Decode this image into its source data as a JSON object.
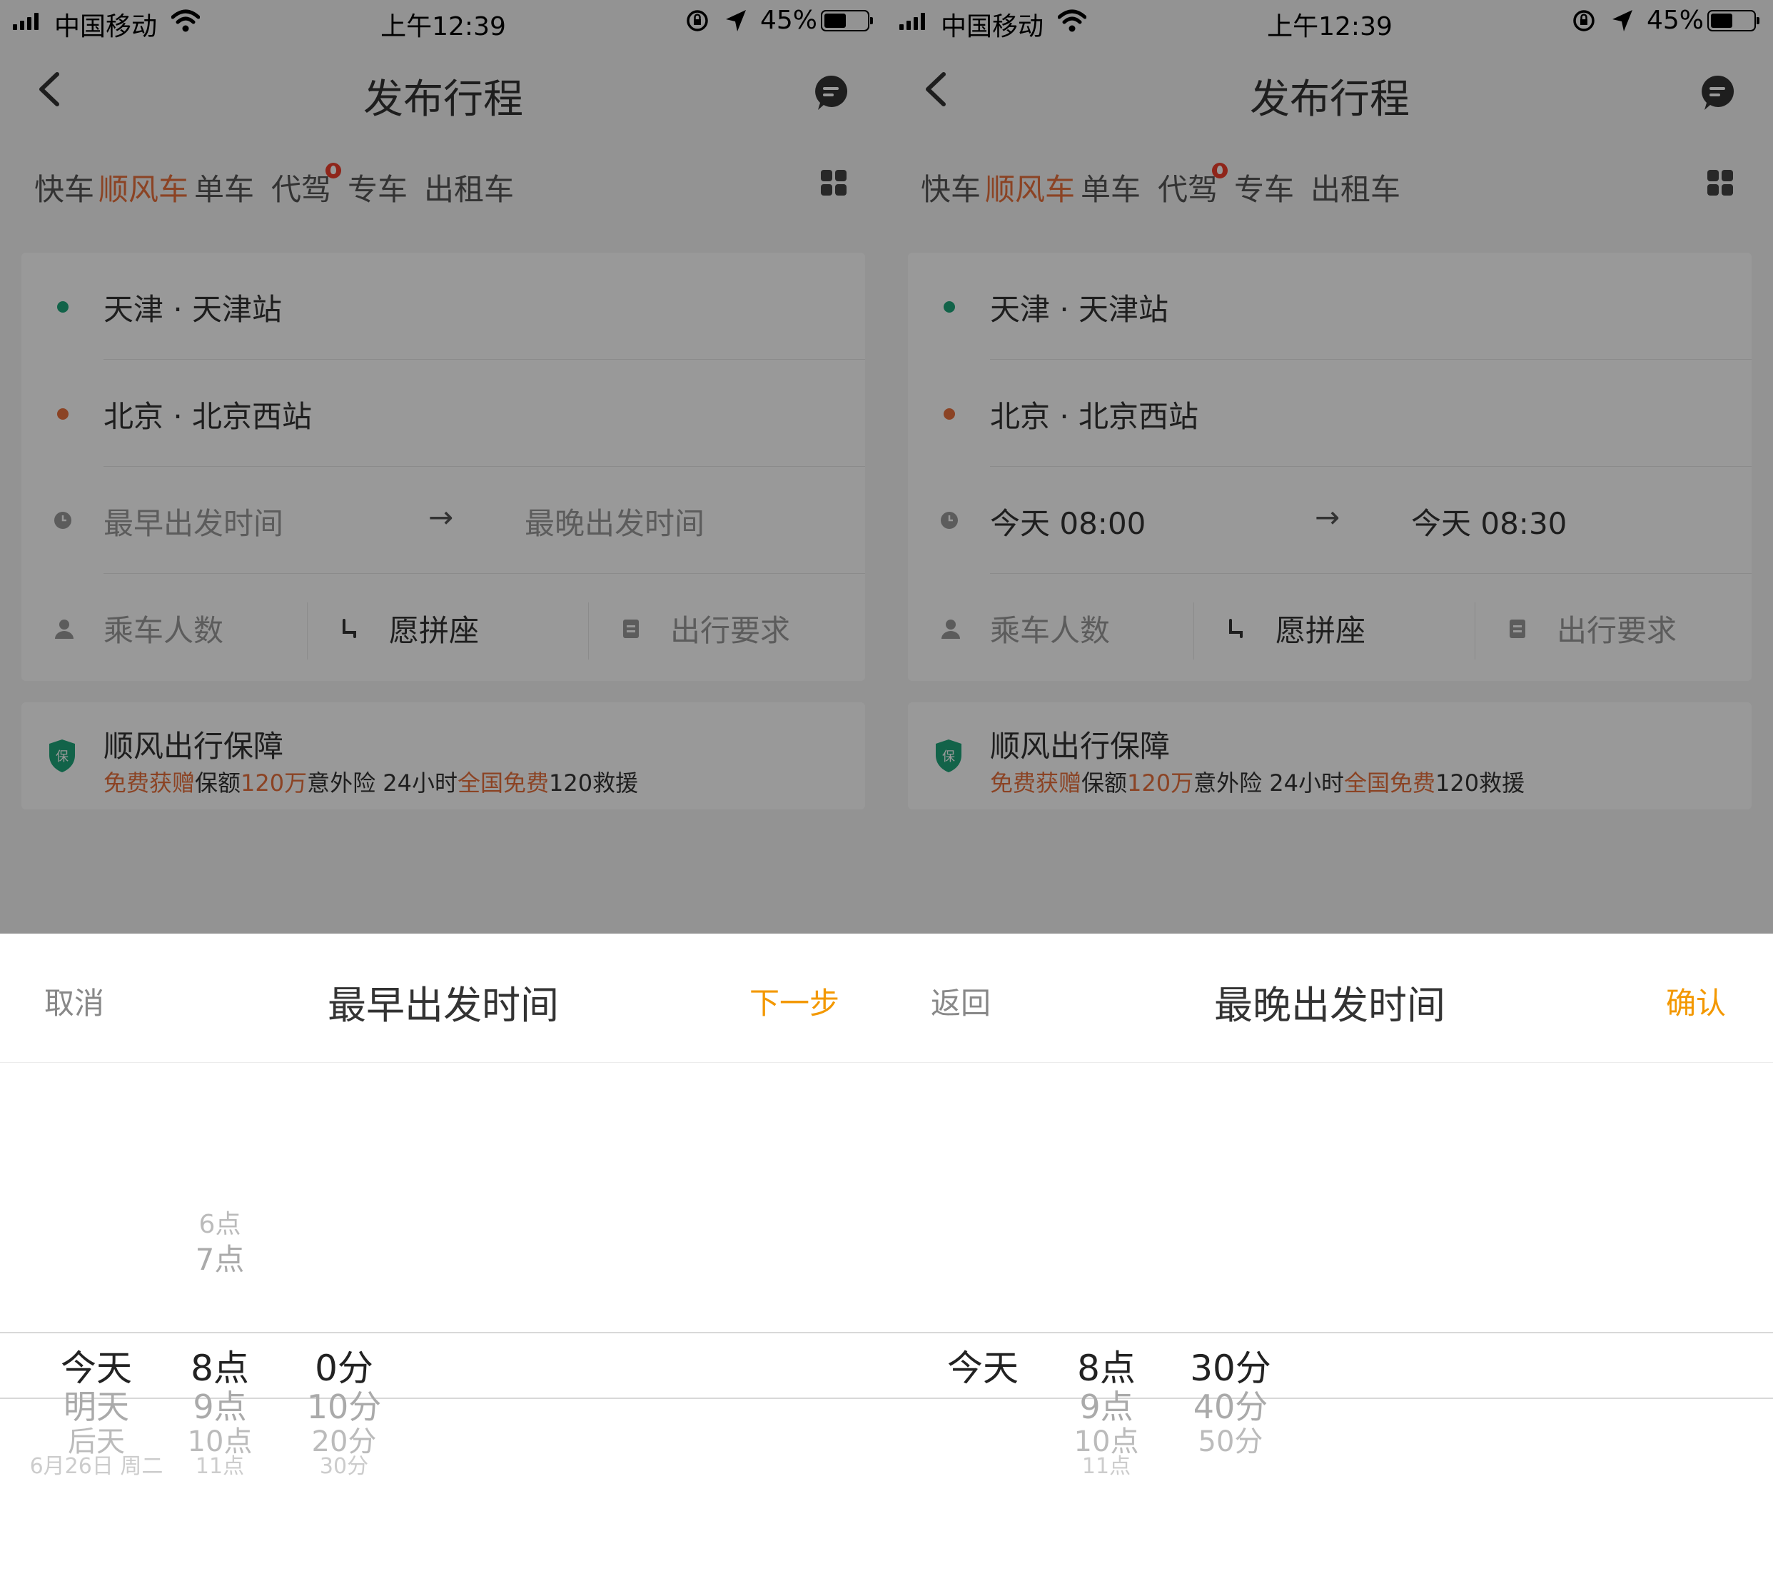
{
  "screens": [
    {
      "status": {
        "carrier": "中国移动",
        "time": "上午12:39",
        "battery": "45%"
      },
      "nav": {
        "title": "发布行程"
      },
      "tabs": [
        {
          "label": "快车"
        },
        {
          "label": "顺风车",
          "active": true
        },
        {
          "label": "单车"
        },
        {
          "label": "代驾",
          "badge": "fire"
        },
        {
          "label": "专车"
        },
        {
          "label": "出租车"
        }
      ],
      "trip": {
        "from": "天津 · 天津站",
        "to": "北京 · 北京西站",
        "time_from": "最早出发时间",
        "arrow": "→",
        "time_to": "最晚出发时间",
        "passengers": "乘车人数",
        "carpool": "愿拼座",
        "requirements": "出行要求"
      },
      "guarantee": {
        "title": "顺风出行保障",
        "desc_parts": [
          "免费获赠",
          "保额",
          "120万",
          "意外险 24小时",
          "全国免费",
          "120救援"
        ]
      },
      "sheet": {
        "left": "取消",
        "title": "最早出发时间",
        "right": "下一步"
      },
      "picker": {
        "days": [
          "今天",
          "明天",
          "后天",
          "6月26日 周二"
        ],
        "hours": [
          "6点",
          "7点",
          "8点",
          "9点",
          "10点",
          "11点"
        ],
        "minutes": [
          "0分",
          "10分",
          "20分",
          "30分"
        ],
        "selected": {
          "day": "今天",
          "hour": "8点",
          "minute": "0分"
        }
      }
    },
    {
      "status": {
        "carrier": "中国移动",
        "time": "上午12:39",
        "battery": "45%"
      },
      "nav": {
        "title": "发布行程"
      },
      "tabs": [
        {
          "label": "快车"
        },
        {
          "label": "顺风车",
          "active": true
        },
        {
          "label": "单车"
        },
        {
          "label": "代驾",
          "badge": "fire"
        },
        {
          "label": "专车"
        },
        {
          "label": "出租车"
        }
      ],
      "trip": {
        "from": "天津 · 天津站",
        "to": "北京 · 北京西站",
        "time_from": "今天 08:00",
        "arrow": "→",
        "time_to": "今天 08:30",
        "passengers": "乘车人数",
        "carpool": "愿拼座",
        "requirements": "出行要求"
      },
      "guarantee": {
        "title": "顺风出行保障",
        "desc_parts": [
          "免费获赠",
          "保额",
          "120万",
          "意外险 24小时",
          "全国免费",
          "120救援"
        ]
      },
      "sheet": {
        "left": "返回",
        "title": "最晚出发时间",
        "right": "确认"
      },
      "picker": {
        "days": [
          "今天"
        ],
        "hours": [
          "8点",
          "9点",
          "10点",
          "11点"
        ],
        "minutes": [
          "30分",
          "40分",
          "50分"
        ],
        "selected": {
          "day": "今天",
          "hour": "8点",
          "minute": "30分"
        }
      }
    }
  ],
  "colors": {
    "accent": "#e8713c",
    "action": "#f39800",
    "from_dot": "#1fa67a",
    "to_dot": "#e8713c",
    "shield": "#1fa67a",
    "overlay": "rgba(0,0,0,0.4)"
  },
  "icons": [
    "signal-icon",
    "wifi-icon",
    "orientation-lock-icon",
    "location-arrow-icon",
    "battery-icon",
    "back-chevron-icon",
    "message-icon",
    "fire-badge-icon",
    "grid-more-icon",
    "clock-icon",
    "person-icon",
    "seat-icon",
    "note-icon",
    "shield-icon"
  ]
}
